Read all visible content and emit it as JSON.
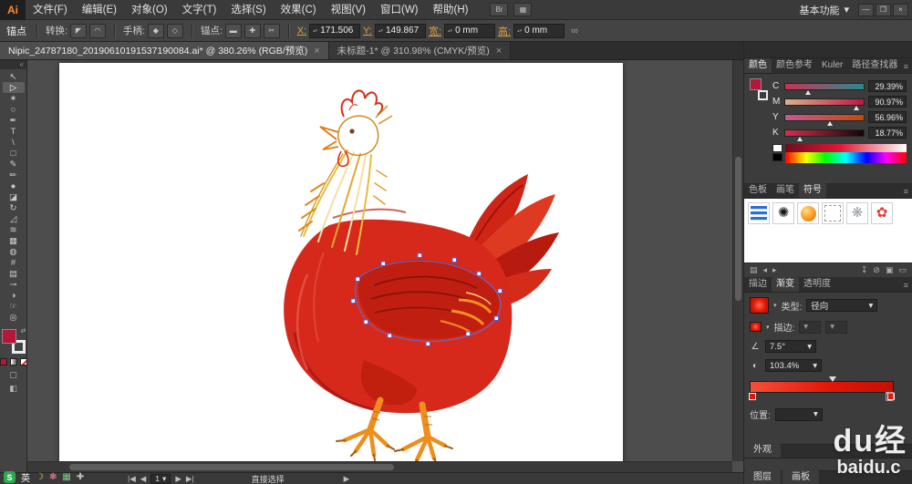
{
  "ui": {
    "caret": "▾",
    "panel_menu": "≡",
    "collapse_left": "«",
    "spin": "▴▾"
  },
  "menubar": {
    "logo": "Ai",
    "items": [
      "文件(F)",
      "编辑(E)",
      "对象(O)",
      "文字(T)",
      "选择(S)",
      "效果(C)",
      "视图(V)",
      "窗口(W)",
      "帮助(H)"
    ],
    "icon_buttons": [
      {
        "name": "bridge-icon",
        "glyph": "Br"
      },
      {
        "name": "arrange-documents-icon",
        "glyph": "▦"
      }
    ],
    "workspace_label": "基本功能",
    "window_buttons": [
      {
        "name": "minimize-button",
        "glyph": "—"
      },
      {
        "name": "restore-button",
        "glyph": "❐"
      },
      {
        "name": "close-button",
        "glyph": "×"
      }
    ]
  },
  "controlbar": {
    "mode_label": "锚点",
    "convert_label": "转换:",
    "convert_buttons": [
      {
        "name": "convert-to-corner-icon",
        "glyph": "◤"
      },
      {
        "name": "convert-to-smooth-icon",
        "glyph": "◠"
      }
    ],
    "handles_label": "手柄:",
    "handle_buttons": [
      {
        "name": "show-handles-icon",
        "glyph": "◆"
      },
      {
        "name": "hide-handles-icon",
        "glyph": "◇"
      }
    ],
    "anchors_label": "锚点:",
    "anchor_buttons": [
      {
        "name": "remove-anchor-icon",
        "glyph": "▬"
      },
      {
        "name": "add-anchor-icon",
        "glyph": "✚"
      },
      {
        "name": "cut-path-icon",
        "glyph": "✂"
      }
    ],
    "fields": [
      {
        "name": "x-field",
        "label": "X:",
        "value": "171.506"
      },
      {
        "name": "y-field",
        "label": "Y:",
        "value": "149.867"
      },
      {
        "name": "width-field",
        "label": "宽:",
        "value": "0 mm"
      },
      {
        "name": "height-field",
        "label": "高:",
        "value": "0 mm"
      }
    ],
    "link_glyph": "∞"
  },
  "doc_tabs": [
    {
      "title": "Nipic_24787180_20190610191537190084.ai* @ 380.26% (RGB/预览)",
      "close": "×",
      "active": true
    },
    {
      "title": "未标题-1* @ 310.98% (CMYK/预览)",
      "close": "×",
      "active": false
    }
  ],
  "toolbar": {
    "fill_color": "#b5173b",
    "stroke_color": "#ffffff",
    "tools": [
      {
        "name": "selection-tool",
        "glyph": "↖"
      },
      {
        "name": "direct-selection-tool",
        "glyph": "▷",
        "active": true
      },
      {
        "name": "magic-wand-tool",
        "glyph": "✶"
      },
      {
        "name": "lasso-tool",
        "glyph": "○"
      },
      {
        "name": "pen-tool",
        "glyph": "✒"
      },
      {
        "name": "type-tool",
        "glyph": "T"
      },
      {
        "name": "line-segment-tool",
        "glyph": "\\"
      },
      {
        "name": "rectangle-tool",
        "glyph": "□"
      },
      {
        "name": "paintbrush-tool",
        "glyph": "✎"
      },
      {
        "name": "pencil-tool",
        "glyph": "✏"
      },
      {
        "name": "blob-brush-tool",
        "glyph": "●"
      },
      {
        "name": "eraser-tool",
        "glyph": "◪"
      },
      {
        "name": "rotate-tool",
        "glyph": "↻"
      },
      {
        "name": "scale-tool",
        "glyph": "◿"
      },
      {
        "name": "width-tool",
        "glyph": "≋"
      },
      {
        "name": "free-transform-tool",
        "glyph": "▦"
      },
      {
        "name": "shape-builder-tool",
        "glyph": "◍"
      },
      {
        "name": "mesh-tool",
        "glyph": "#"
      },
      {
        "name": "gradient-tool",
        "glyph": "▤"
      },
      {
        "name": "eyedropper-tool",
        "glyph": "⊸"
      },
      {
        "name": "blend-tool",
        "glyph": "◑"
      },
      {
        "name": "hand-tool",
        "glyph": "☞"
      },
      {
        "name": "zoom-tool",
        "glyph": "◎"
      }
    ]
  },
  "color_panel": {
    "tabs": [
      "颜色",
      "颜色参考",
      "Kuler",
      "路径查找器"
    ],
    "active_tab_index": 0,
    "fill_color": "#b5173b",
    "channels": [
      {
        "key": "c",
        "label": "C",
        "value": "29.39%",
        "pct": 29
      },
      {
        "key": "m",
        "label": "M",
        "value": "90.97%",
        "pct": 91
      },
      {
        "key": "y",
        "label": "Y",
        "value": "56.96%",
        "pct": 57
      },
      {
        "key": "k",
        "label": "K",
        "value": "18.77%",
        "pct": 19
      }
    ]
  },
  "swatch_panel": {
    "tabs": [
      "色板",
      "画笔",
      "符号"
    ],
    "active_tab_index": 2,
    "symbols": [
      {
        "name": "symbol-blue-stripes",
        "css": "sym-stripes"
      },
      {
        "name": "symbol-ink-splat",
        "css": "sym-glyph",
        "glyph": "✺",
        "color": "#1a1a1a"
      },
      {
        "name": "symbol-orange-orb",
        "css": "sym-orb"
      },
      {
        "name": "symbol-empty-dashed",
        "css": "sym-dashed"
      },
      {
        "name": "symbol-gray-flower",
        "css": "sym-glyph",
        "glyph": "❋",
        "color": "#9aa0a6"
      },
      {
        "name": "symbol-red-flower",
        "css": "sym-glyph",
        "glyph": "✿",
        "color": "#e03a30"
      }
    ],
    "footer_icons": [
      {
        "name": "symbol-libraries-icon",
        "glyph": "▤"
      },
      {
        "name": "prev-page-icon",
        "glyph": "◂"
      },
      {
        "name": "next-page-icon",
        "glyph": "▸"
      },
      {
        "name": "place-symbol-icon",
        "glyph": "↧"
      },
      {
        "name": "break-link-icon",
        "glyph": "⊘"
      },
      {
        "name": "new-symbol-icon",
        "glyph": "▣"
      },
      {
        "name": "delete-symbol-icon",
        "glyph": "▭"
      }
    ]
  },
  "gradient_panel": {
    "tabs": [
      "描边",
      "渐变",
      "透明度"
    ],
    "active_tab_index": 1,
    "type_label": "类型:",
    "type_value": "径向",
    "stroke_label": "描边:",
    "angle_icon": "∠",
    "angle_value": "7.5°",
    "aspect_icon": "◐",
    "aspect_value": "103.4%",
    "location_label": "位置:",
    "location_value": "",
    "gradient_colors": [
      "#f4503a",
      "#c21005"
    ]
  },
  "bottom_panels": {
    "appearance_tab": "外观",
    "layers_tab": "图层",
    "artboards_tab": "画板"
  },
  "watermark": {
    "line1": "du经",
    "line2": "baidu.c"
  },
  "statusbar": {
    "first": "|◀",
    "prev": "◀",
    "artboard": "1",
    "next": "▶",
    "last": "▶|",
    "tool": "直接选择",
    "menu": "▶"
  },
  "ime": {
    "logo": "S",
    "lang": "英",
    "icons": [
      {
        "name": "ime-moon-icon",
        "glyph": "☽",
        "color": "#f2c14e"
      },
      {
        "name": "ime-paw-icon",
        "glyph": "❃",
        "color": "#e2788c"
      },
      {
        "name": "ime-board-icon",
        "glyph": "▦",
        "color": "#7fc97f"
      },
      {
        "name": "ime-wrench-icon",
        "glyph": "✚",
        "color": "#c0c0c0"
      }
    ]
  }
}
